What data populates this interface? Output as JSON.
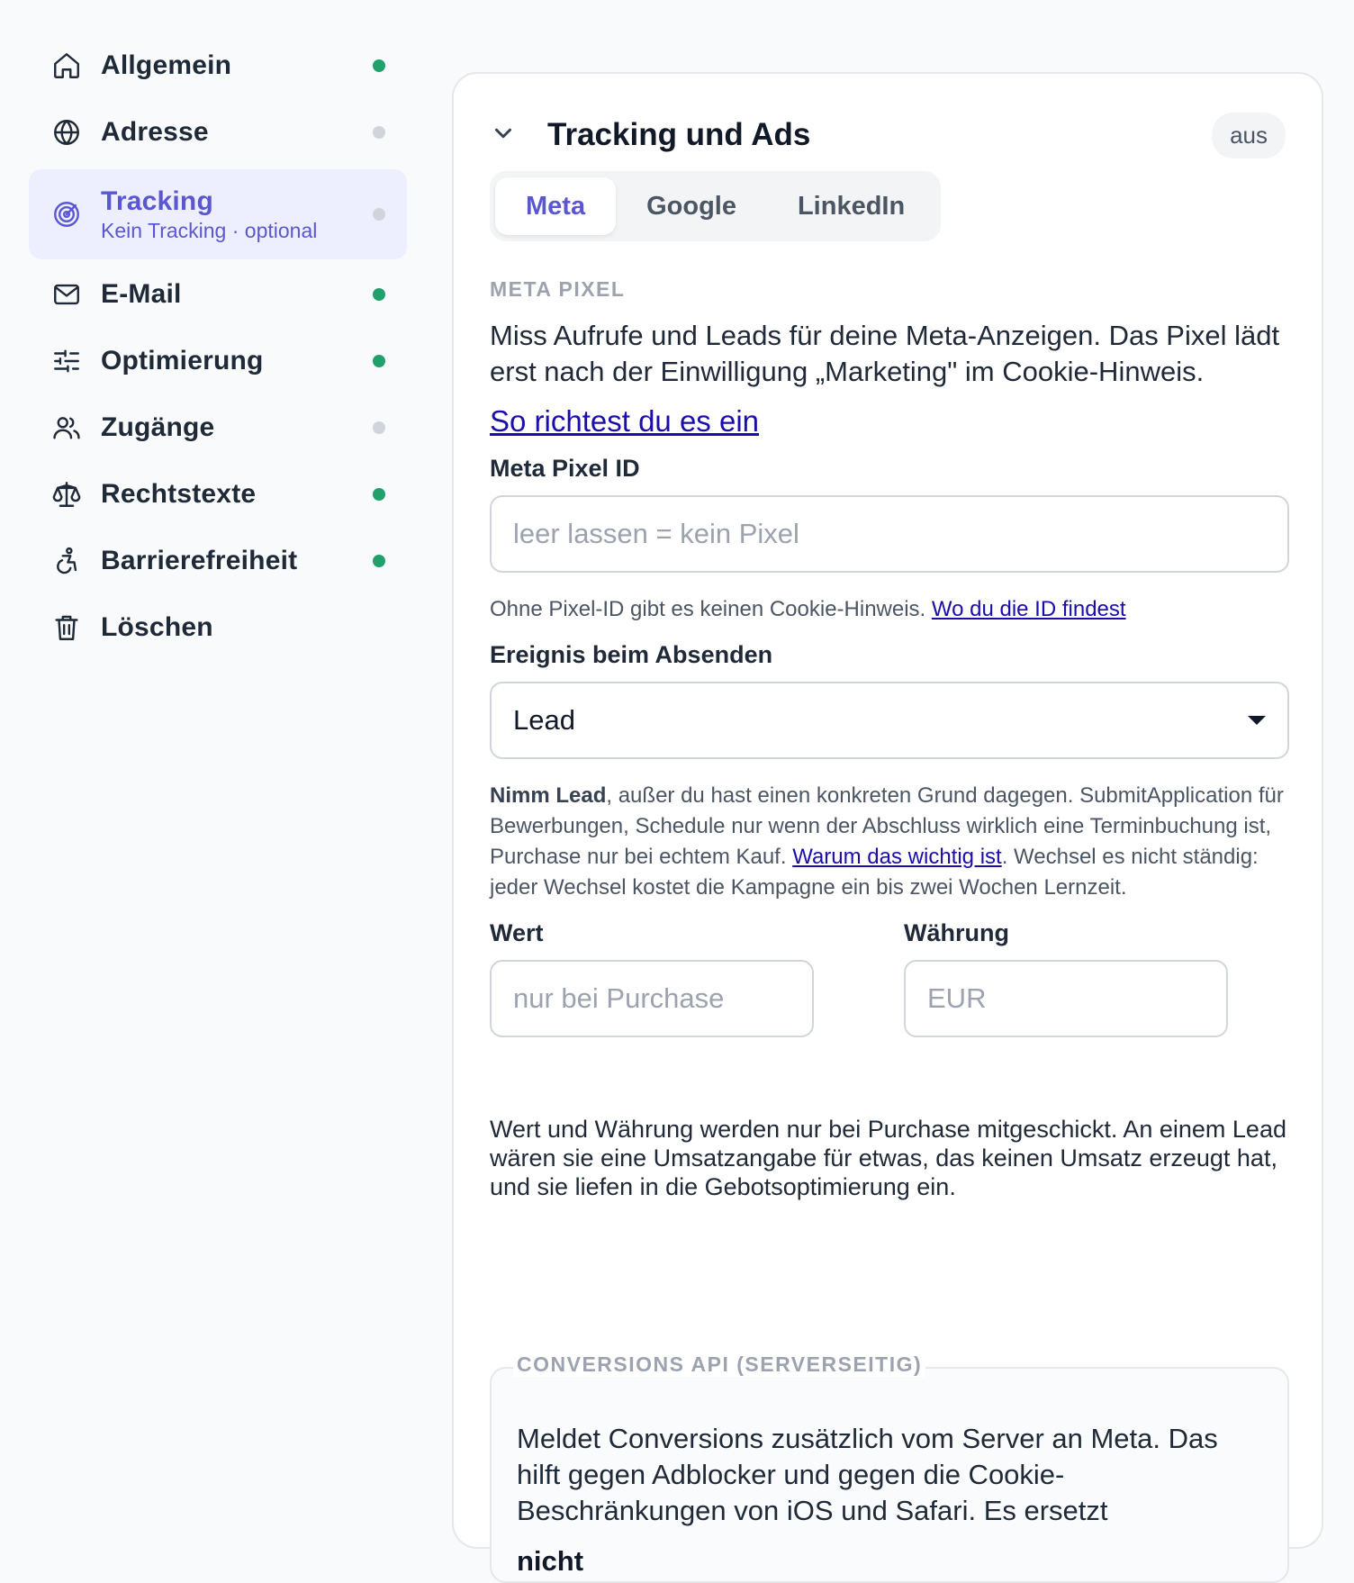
{
  "sidebar": {
    "items": [
      {
        "label": "Allgemein",
        "icon": "home-icon",
        "status": "green"
      },
      {
        "label": "Adresse",
        "icon": "globe-icon",
        "status": "gray"
      },
      {
        "label": "Tracking",
        "sublabel": "Kein Tracking · optional",
        "icon": "radar-icon",
        "status": "gray",
        "active": true
      },
      {
        "label": "E-Mail",
        "icon": "mail-icon",
        "status": "green"
      },
      {
        "label": "Optimierung",
        "icon": "sliders-icon",
        "status": "green"
      },
      {
        "label": "Zugänge",
        "icon": "users-icon",
        "status": "gray"
      },
      {
        "label": "Rechtstexte",
        "icon": "scale-icon",
        "status": "green"
      },
      {
        "label": "Barrierefreiheit",
        "icon": "accessibility-icon",
        "status": "green"
      },
      {
        "label": "Löschen",
        "icon": "trash-icon",
        "status": "none"
      }
    ]
  },
  "colors": {
    "green": "#22a06b",
    "gray": "#d1d5db",
    "accent": "#5b57d1",
    "link": "#1a0dab"
  },
  "card": {
    "title": "Tracking und Ads",
    "badge": "aus",
    "tabs": [
      "Meta",
      "Google",
      "LinkedIn"
    ],
    "active_tab": "Meta"
  },
  "meta": {
    "section_label": "META PIXEL",
    "description": "Miss Aufrufe und Leads für deine Meta-Anzeigen. Das Pixel lädt erst nach der Einwilligung „Marketing\" im Cookie-Hinweis.",
    "setup_link": "So richtest du es ein",
    "pixel_id_label": "Meta Pixel ID",
    "pixel_id_placeholder": "leer lassen = kein Pixel",
    "pixel_hint": "Ohne Pixel-ID gibt es keinen Cookie-Hinweis. ",
    "pixel_hint_link": "Wo du die ID findest",
    "event_label": "Ereignis beim Absenden",
    "event_value": "Lead",
    "event_hint_bold": "Nimm Lead",
    "event_hint_1": ", außer du hast einen konkreten Grund dagegen. SubmitApplication für Bewerbungen, Schedule nur wenn der Abschluss wirklich eine Terminbuchung ist, Purchase nur bei echtem Kauf. ",
    "event_hint_link": "Warum das wichtig ist",
    "event_hint_2": ". Wechsel es nicht ständig: jeder Wechsel kostet die Kampagne ein bis zwei Wochen Lernzeit.",
    "value_label": "Wert",
    "value_placeholder": "nur bei Purchase",
    "currency_label": "Währung",
    "currency_placeholder": "EUR",
    "value_note": "Wert und Währung werden nur bei Purchase mitgeschickt. An einem Lead wären sie eine Umsatzangabe für etwas, das keinen Umsatz erzeugt hat, und sie liefen in die Gebotsoptimierung ein.",
    "capi_legend": "CONVERSIONS API (SERVERSEITIG)",
    "capi_text": "Meldet Conversions zusätzlich vom Server an Meta. Das hilft gegen Adblocker und gegen die Cookie-Beschränkungen von iOS und Safari. Es ersetzt",
    "capi_bold": "nicht"
  }
}
